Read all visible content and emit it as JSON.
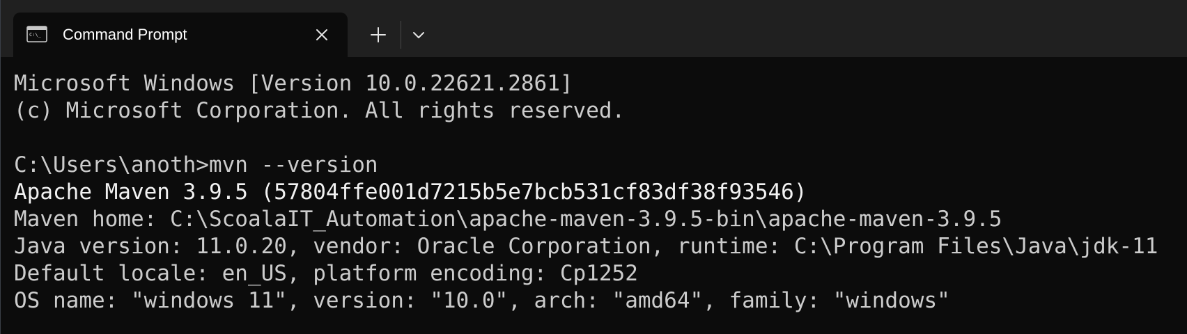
{
  "window": {
    "tab_title": "Command Prompt",
    "tab_icon": "command-prompt-icon",
    "close_icon": "close-icon",
    "new_tab_icon": "plus-icon",
    "dropdown_icon": "chevron-down-icon"
  },
  "colors": {
    "terminal_background": "#0c0c0c",
    "titlebar_background": "#202020",
    "text": "#cccccc",
    "bright_text": "#f2f2f2"
  },
  "terminal": {
    "lines": [
      "Microsoft Windows [Version 10.0.22621.2861]",
      "(c) Microsoft Corporation. All rights reserved.",
      "",
      "C:\\Users\\anoth>mvn --version",
      "Apache Maven 3.9.5 (57804ffe001d7215b5e7bcb531cf83df38f93546)",
      "Maven home: C:\\ScoalaIT_Automation\\apache-maven-3.9.5-bin\\apache-maven-3.9.5",
      "Java version: 11.0.20, vendor: Oracle Corporation, runtime: C:\\Program Files\\Java\\jdk-11",
      "Default locale: en_US, platform encoding: Cp1252",
      "OS name: \"windows 11\", version: \"10.0\", arch: \"amd64\", family: \"windows\""
    ]
  }
}
